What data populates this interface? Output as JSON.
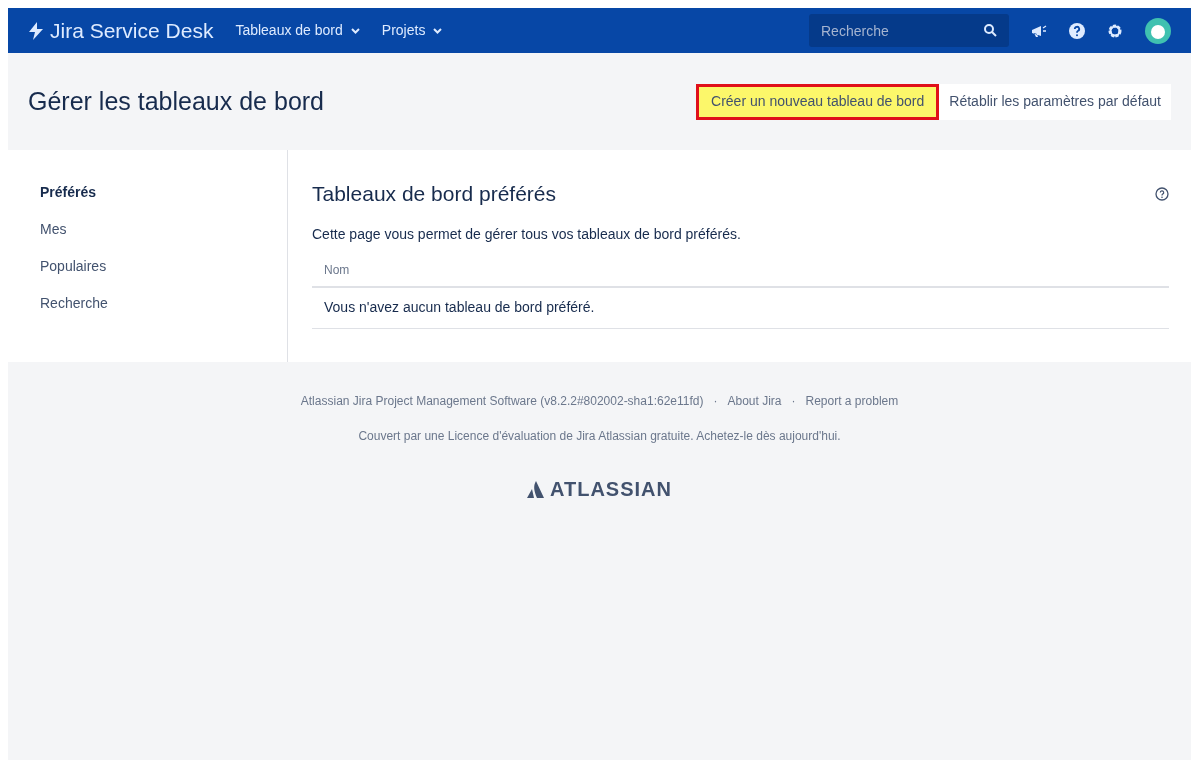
{
  "header": {
    "product": "Jira Service Desk",
    "menus": [
      {
        "label": "Tableaux de bord"
      },
      {
        "label": "Projets"
      }
    ],
    "search": {
      "placeholder": "Recherche"
    }
  },
  "page": {
    "title": "Gérer les tableaux de bord",
    "actions": [
      {
        "label": "Créer un nouveau tableau de bord",
        "highlighted": true
      },
      {
        "label": "Rétablir les paramètres par défaut",
        "highlighted": false
      }
    ]
  },
  "sidebar": {
    "items": [
      {
        "label": "Préférés",
        "selected": true
      },
      {
        "label": "Mes",
        "selected": false
      },
      {
        "label": "Populaires",
        "selected": false
      },
      {
        "label": "Recherche",
        "selected": false
      }
    ]
  },
  "content": {
    "heading": "Tableaux de bord préférés",
    "description": "Cette page vous permet de gérer tous vos tableaux de bord préférés.",
    "table": {
      "columns": [
        "Nom"
      ],
      "empty_message": "Vous n'avez aucun tableau de bord préféré."
    }
  },
  "footer": {
    "links": [
      "Atlassian Jira Project Management Software (v8.2.2#802002-sha1:62e11fd)",
      "About Jira",
      "Report a problem"
    ],
    "separator": "·",
    "license": "Couvert par une Licence d'évaluation de Jira Atlassian gratuite. Achetez-le dès aujourd'hui.",
    "brand": "ATLASSIAN"
  }
}
